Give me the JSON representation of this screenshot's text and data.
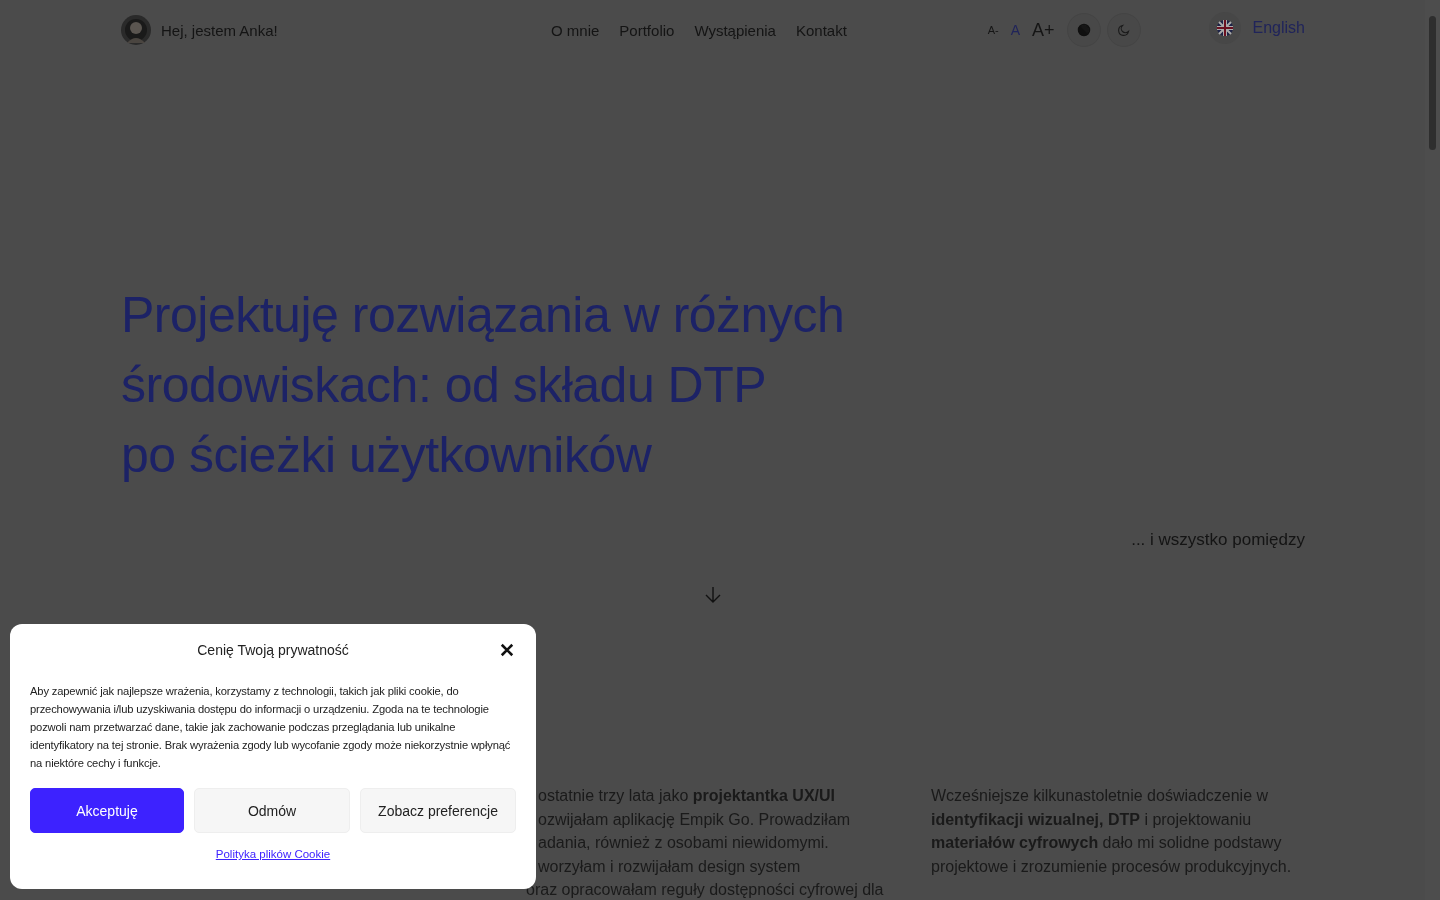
{
  "header": {
    "site_title": "Hej, jestem Anka!",
    "nav": [
      {
        "label": "O mnie"
      },
      {
        "label": "Portfolio"
      },
      {
        "label": "Wystąpienia"
      },
      {
        "label": "Kontakt"
      }
    ],
    "font_size": [
      {
        "label": "A-",
        "selected": false
      },
      {
        "label": "A",
        "selected": true
      },
      {
        "label": "A+",
        "selected": false
      }
    ],
    "language": "English"
  },
  "hero": {
    "heading_lines": [
      "Projektuję rozwiązania w różnych",
      "środowiskach: od składu DTP",
      "po ścieżki użytkowników"
    ],
    "tagline": "... i wszystko pomiędzy"
  },
  "intro": {
    "column_2_lines": [
      {
        "text": "ostatnie trzy lata jako **projektantka UX/UI**",
        "covered": true
      },
      {
        "text": "ozwijałam aplikację Empik Go. Prowadziłam",
        "covered": true
      },
      {
        "text": "adania, również z osobami niewidomymi.",
        "covered": true
      },
      {
        "text": "worzyłam i rozwijałam design system",
        "covered": true
      },
      {
        "text": "oraz opracowałam reguły dostępności cyfrowej dla",
        "covered": false
      }
    ],
    "column_3": "Wcześniejsze kilkunastoletnie doświadczenie w **identyfikacji wizualnej, DTP** i projektowaniu **materiałów cyfrowych** dało mi solidne podstawy projektowe i zrozumienie procesów produkcyjnych."
  },
  "cookie_dialog": {
    "title": "Cenię Twoją prywatność",
    "body": "Aby zapewnić jak najlepsze wrażenia, korzystamy z technologii, takich jak pliki cookie, do przechowywania i/lub uzyskiwania dostępu do informacji o urządzeniu. Zgoda na te technologie pozwoli nam przetwarzać dane, takie jak zachowanie podczas przeglądania lub unikalne identyfikatory na tej stronie. Brak wyrażenia zgody lub wycofanie zgody może niekorzystnie wpłynąć na niektóre cechy i funkcje.",
    "buttons": [
      {
        "label": "Akceptuję",
        "kind": "primary"
      },
      {
        "label": "Odmów",
        "kind": "secondary"
      },
      {
        "label": "Zobacz preferencje",
        "kind": "secondary"
      }
    ],
    "link": "Polityka plików Cookie"
  }
}
